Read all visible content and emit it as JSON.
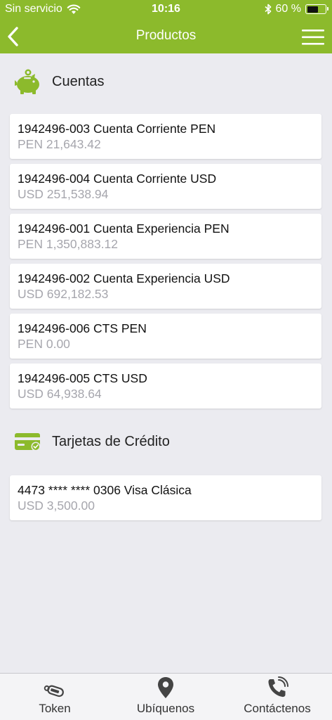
{
  "status_bar": {
    "carrier": "Sin servicio",
    "time": "10:16",
    "battery": "60 %",
    "battery_level": 0.6
  },
  "nav": {
    "title": "Productos"
  },
  "sections": {
    "accounts_title": "Cuentas",
    "cards_title": "Tarjetas de Crédito"
  },
  "accounts": [
    {
      "name": "1942496-003 Cuenta Corriente PEN",
      "amount": "PEN 21,643.42"
    },
    {
      "name": "1942496-004 Cuenta Corriente USD",
      "amount": "USD 251,538.94"
    },
    {
      "name": "1942496-001 Cuenta Experiencia PEN",
      "amount": "PEN 1,350,883.12"
    },
    {
      "name": "1942496-002 Cuenta Experiencia USD",
      "amount": "USD 692,182.53"
    },
    {
      "name": "1942496-006 CTS PEN",
      "amount": "PEN 0.00"
    },
    {
      "name": "1942496-005 CTS USD",
      "amount": "USD 64,938.64"
    }
  ],
  "credit_cards": [
    {
      "name": "4473 **** **** 0306 Visa Clásica",
      "amount": "USD 3,500.00"
    }
  ],
  "tabbar": {
    "token": "Token",
    "locate": "Ubíquenos",
    "contact": "Contáctenos"
  },
  "colors": {
    "brand_green": "#8cba2c",
    "background": "#ebebf0",
    "muted_text": "#a6a6ad"
  },
  "icons": [
    "wifi-icon",
    "bluetooth-icon",
    "battery-icon",
    "back-chevron-icon",
    "hamburger-menu-icon",
    "piggy-bank-icon",
    "credit-card-icon",
    "token-icon",
    "location-pin-icon",
    "phone-icon"
  ]
}
